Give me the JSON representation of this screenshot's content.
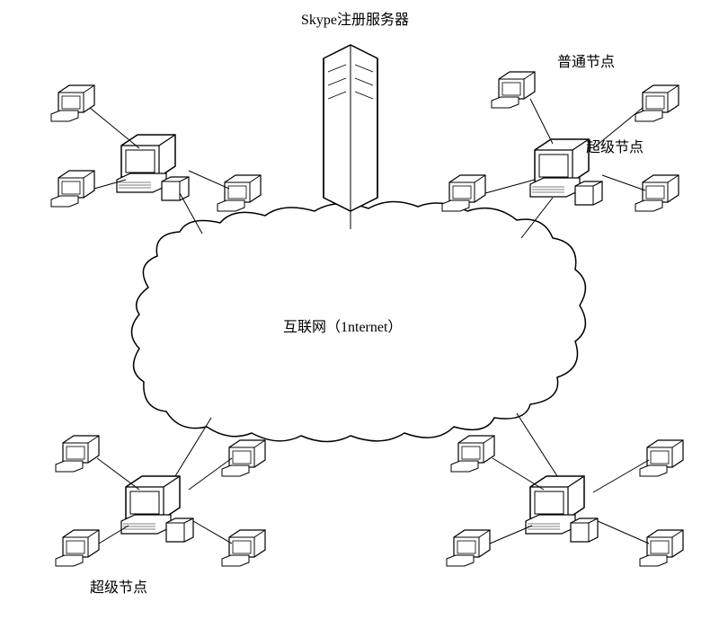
{
  "labels": {
    "title": "Skype注册服务器",
    "ordinaryNode": "普通节点",
    "superNodeTop": "超级节点",
    "internet": "互联网（1nternet）",
    "superNodeBottom": "超级节点"
  }
}
